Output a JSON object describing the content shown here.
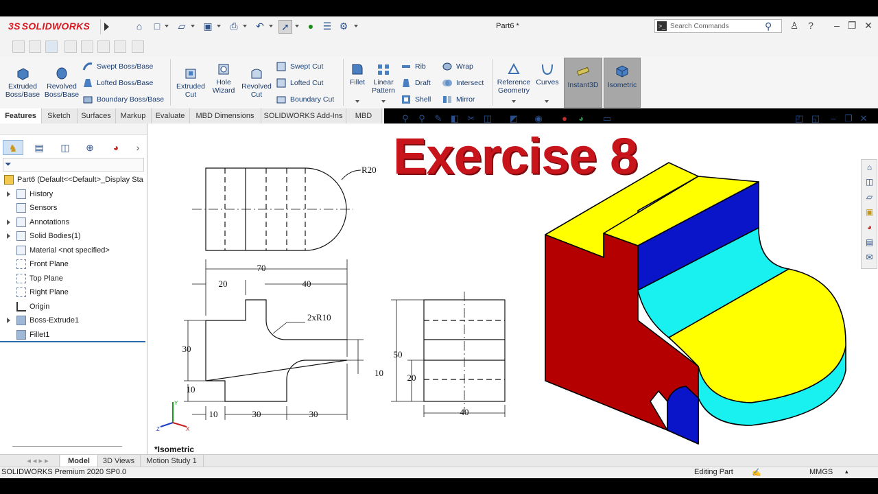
{
  "app": {
    "logo_ds": "3S",
    "logo_text": "SOLIDWORKS",
    "document_title": "Part6 *",
    "search_placeholder": "Search Commands"
  },
  "ribbon": {
    "extruded_boss": "Extruded Boss/Base",
    "revolved_boss": "Revolved Boss/Base",
    "swept_boss": "Swept Boss/Base",
    "lofted_boss": "Lofted Boss/Base",
    "boundary_boss": "Boundary Boss/Base",
    "extruded_cut": "Extruded Cut",
    "hole_wizard": "Hole Wizard",
    "revolved_cut": "Revolved Cut",
    "swept_cut": "Swept Cut",
    "lofted_cut": "Lofted Cut",
    "boundary_cut": "Boundary Cut",
    "fillet": "Fillet",
    "linear_pattern": "Linear Pattern",
    "rib": "Rib",
    "draft": "Draft",
    "shell": "Shell",
    "wrap": "Wrap",
    "intersect": "Intersect",
    "mirror": "Mirror",
    "reference_geometry": "Reference Geometry",
    "curves": "Curves",
    "instant3d": "Instant3D",
    "isometric": "Isometric"
  },
  "tabs": [
    "Features",
    "Sketch",
    "Surfaces",
    "Markup",
    "Evaluate",
    "MBD Dimensions",
    "SOLIDWORKS Add-Ins",
    "MBD"
  ],
  "tree": {
    "root": "Part6  (Default<<Default>_Display Sta",
    "items": [
      {
        "label": "History",
        "expand": true
      },
      {
        "label": "Sensors",
        "expand": false
      },
      {
        "label": "Annotations",
        "expand": true
      },
      {
        "label": "Solid Bodies(1)",
        "expand": true
      },
      {
        "label": "Material <not specified>",
        "expand": false
      },
      {
        "label": "Front Plane",
        "expand": false
      },
      {
        "label": "Top Plane",
        "expand": false
      },
      {
        "label": "Right Plane",
        "expand": false
      },
      {
        "label": "Origin",
        "expand": false
      },
      {
        "label": "Boss-Extrude1",
        "expand": true
      },
      {
        "label": "Fillet1",
        "expand": false
      }
    ]
  },
  "viewport": {
    "heading": "Exercise 8",
    "view_label": "*Isometric",
    "dims": {
      "r20": "R20",
      "d70": "70",
      "d20": "20",
      "d40": "40",
      "r2x10": "2xR10",
      "d30": "30",
      "d10a": "10",
      "d10b": "10",
      "d30b": "30",
      "d30c": "30",
      "d10c": "10",
      "d50": "50",
      "d20b": "20",
      "d40b": "40"
    },
    "triad": {
      "x": "X",
      "y": "Y",
      "z": "Z"
    }
  },
  "bottom_tabs": [
    "Model",
    "3D Views",
    "Motion Study 1"
  ],
  "status": {
    "version": "SOLIDWORKS Premium 2020 SP0.0",
    "mode": "Editing Part",
    "units": "MMGS"
  },
  "colors": {
    "yellow": "#ffff00",
    "blue": "#0a14c8",
    "red": "#b40000",
    "cyan": "#19f0f0",
    "heading_red": "#c8141b"
  }
}
